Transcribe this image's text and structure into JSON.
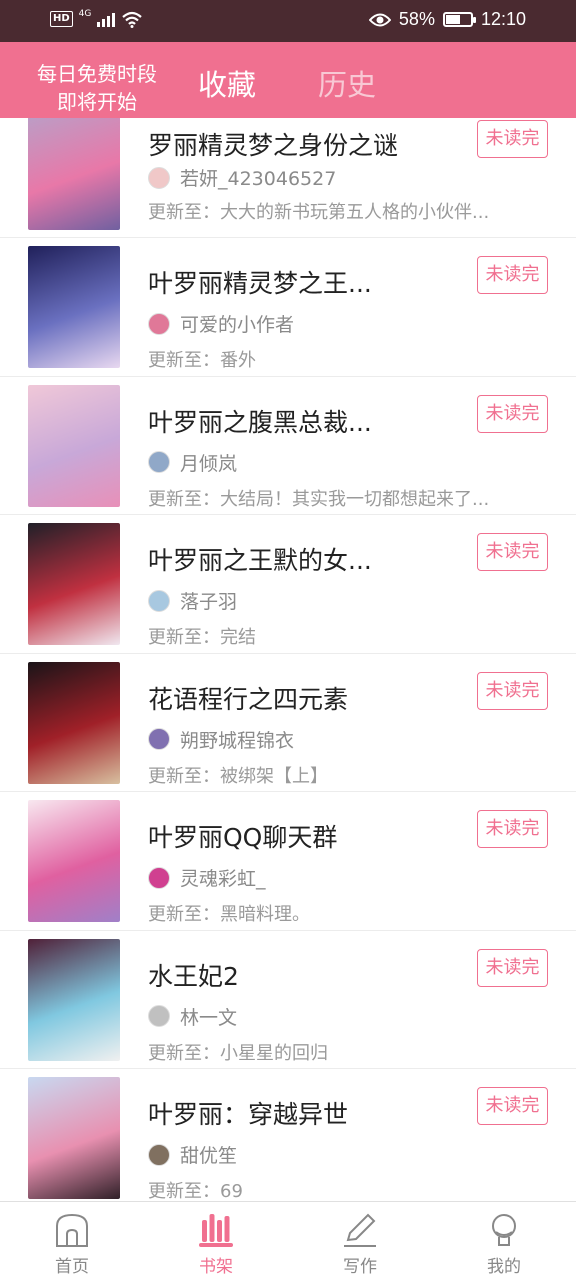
{
  "status_bar": {
    "hd": "HD",
    "network": "4G",
    "battery": "58%",
    "battery_level": 0.58,
    "time": "12:10"
  },
  "header": {
    "promo_line1": "每日免费时段",
    "promo_line2": "即将开始",
    "tab_favorites": "收藏",
    "tab_history": "历史"
  },
  "books": [
    {
      "title": "罗丽精灵梦之身份之谜",
      "author": "若妍_423046527",
      "update": "更新至：大大的新书玩第五人格的小伙伴...",
      "badge": "未读完",
      "cover_colors": [
        "#b8a0c8",
        "#e878a8",
        "#7060a0"
      ],
      "avatar_color": "#f0c8c8"
    },
    {
      "title": "叶罗丽精灵梦之王...",
      "author": "可爱的小作者",
      "update": "更新至：番外",
      "badge": "未读完",
      "cover_colors": [
        "#20205a",
        "#6a70c0",
        "#e8d8f0"
      ],
      "avatar_color": "#e07898"
    },
    {
      "title": "叶罗丽之腹黑总裁...",
      "author": "月倾岚",
      "update": "更新至：大结局！其实我一切都想起来了...",
      "badge": "未读完",
      "cover_colors": [
        "#f0c8d8",
        "#c8a8d8",
        "#e890b8"
      ],
      "avatar_color": "#90a8c8"
    },
    {
      "title": "叶罗丽之王默的女...",
      "author": "落子羽",
      "update": "更新至：完结",
      "badge": "未读完",
      "cover_colors": [
        "#202028",
        "#c03040",
        "#f0e8f0"
      ],
      "avatar_color": "#a8c8e0"
    },
    {
      "title": "花语程行之四元素",
      "author": "朔野城程锦衣",
      "update": "更新至：被绑架【上】",
      "badge": "未读完",
      "cover_colors": [
        "#1a1418",
        "#a02028",
        "#d8c0a0"
      ],
      "avatar_color": "#8070b0"
    },
    {
      "title": "叶罗丽QQ聊天群",
      "author": "灵魂彩虹_",
      "update": "更新至：黑暗料理。",
      "badge": "未读完",
      "cover_colors": [
        "#f8e8f0",
        "#e060a0",
        "#a080c8"
      ],
      "avatar_color": "#d04090"
    },
    {
      "title": "水王妃2",
      "author": "林一文",
      "update": "更新至：小星星的回归",
      "badge": "未读完",
      "cover_colors": [
        "#502038",
        "#80c8e0",
        "#f0f0f0"
      ],
      "avatar_color": "#c0c0c0"
    },
    {
      "title": "叶罗丽：穿越异世",
      "author": "甜优笙",
      "update": "更新至：69",
      "badge": "未读完",
      "cover_colors": [
        "#c8d8f0",
        "#e890b0",
        "#302028"
      ],
      "avatar_color": "#807060"
    }
  ],
  "bottom_nav": [
    {
      "label": "首页",
      "icon": "home-icon",
      "active": false
    },
    {
      "label": "书架",
      "icon": "bookshelf-icon",
      "active": true
    },
    {
      "label": "写作",
      "icon": "pen-icon",
      "active": false
    },
    {
      "label": "我的",
      "icon": "profile-icon",
      "active": false
    }
  ],
  "colors": {
    "accent": "#f07090",
    "status_bar": "#4a2a30"
  }
}
